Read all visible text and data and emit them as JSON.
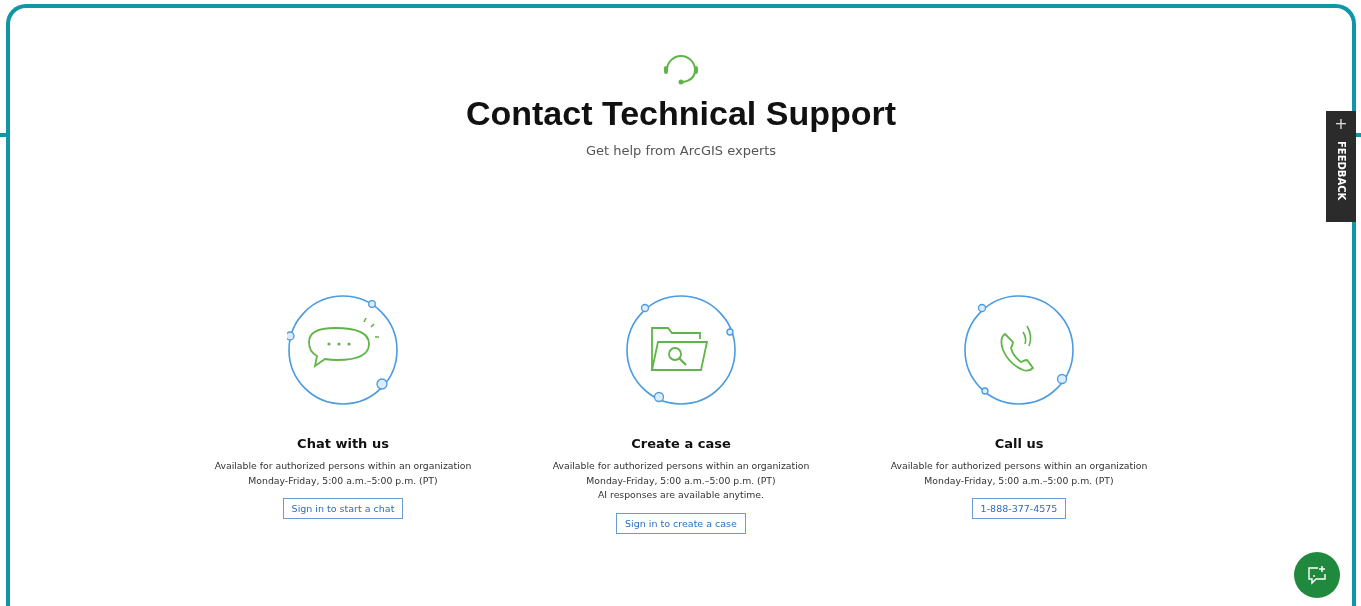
{
  "header": {
    "title": "Contact Technical Support",
    "subtitle": "Get help from ArcGIS experts"
  },
  "cards": [
    {
      "kind": "chat",
      "title": "Chat with us",
      "lines": [
        "Available for authorized persons within an organization",
        "Monday-Friday, 5:00 a.m.–5:00 p.m. (PT)"
      ],
      "action": "Sign in to start a chat"
    },
    {
      "kind": "case",
      "title": "Create a case",
      "lines": [
        "Available for authorized persons within an organization",
        "Monday-Friday, 5:00 a.m.–5:00 p.m. (PT)",
        "AI responses are available anytime."
      ],
      "action": "Sign in to create a case"
    },
    {
      "kind": "call",
      "title": "Call us",
      "lines": [
        "Available for authorized persons within an organization",
        "Monday-Friday, 5:00 a.m.–5:00 p.m. (PT)"
      ],
      "action": "1-888-377-4575"
    }
  ],
  "feedback_tab": {
    "icon": "+",
    "label": "FEEDBACK"
  }
}
